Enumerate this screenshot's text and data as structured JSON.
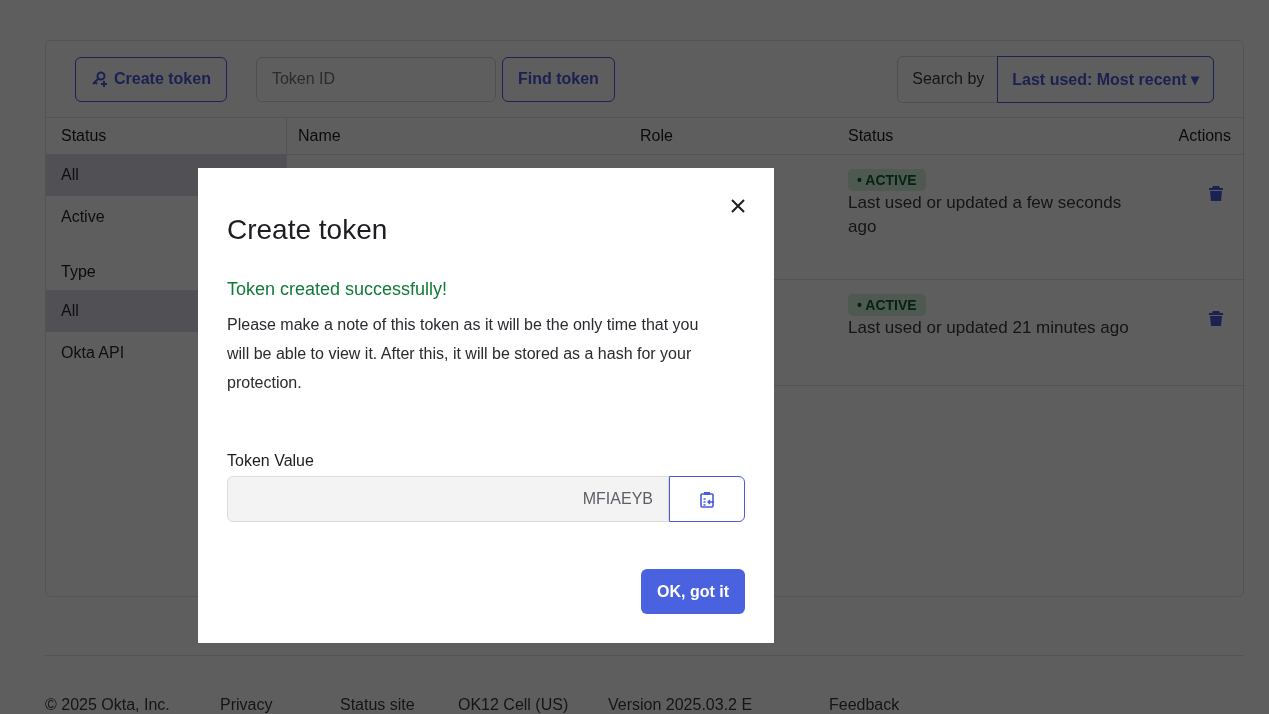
{
  "toolbar": {
    "create_button": "Create token",
    "search": {
      "placeholder": "Token ID"
    },
    "find_button": "Find token",
    "search_by_label": "Search by",
    "sort_dropdown": "Last used: Most recent",
    "sort_caret": "▾"
  },
  "filters": [
    {
      "heading": "Status",
      "items": [
        {
          "label": "All",
          "selected": true
        },
        {
          "label": "Active",
          "selected": false
        }
      ]
    },
    {
      "heading": "Type",
      "items": [
        {
          "label": "All",
          "selected": true
        },
        {
          "label": "Okta API",
          "selected": false
        }
      ]
    }
  ],
  "table": {
    "columns": [
      "Name",
      "Role",
      "Status",
      "Actions"
    ],
    "rows": [
      {
        "badge": "• ACTIVE",
        "last_used": "Last used or updated a few seconds ago"
      },
      {
        "badge": "• ACTIVE",
        "last_used": "Last used or updated 21 minutes ago"
      }
    ]
  },
  "modal": {
    "title": "Create token",
    "success": "Token created successfully!",
    "message": "Please make a note of this token as it will be the only time that you will be able to view it. After this, it will be stored as a hash for your protection.",
    "field_label": "Token Value",
    "field_value": "MFIAEYB",
    "ok_button": "OK, got it"
  },
  "footer": [
    "© 2025 Okta, Inc.",
    "Privacy",
    "Status site",
    "OK12 Cell (US)",
    "Version 2025.03.2 E",
    "Feedback"
  ]
}
